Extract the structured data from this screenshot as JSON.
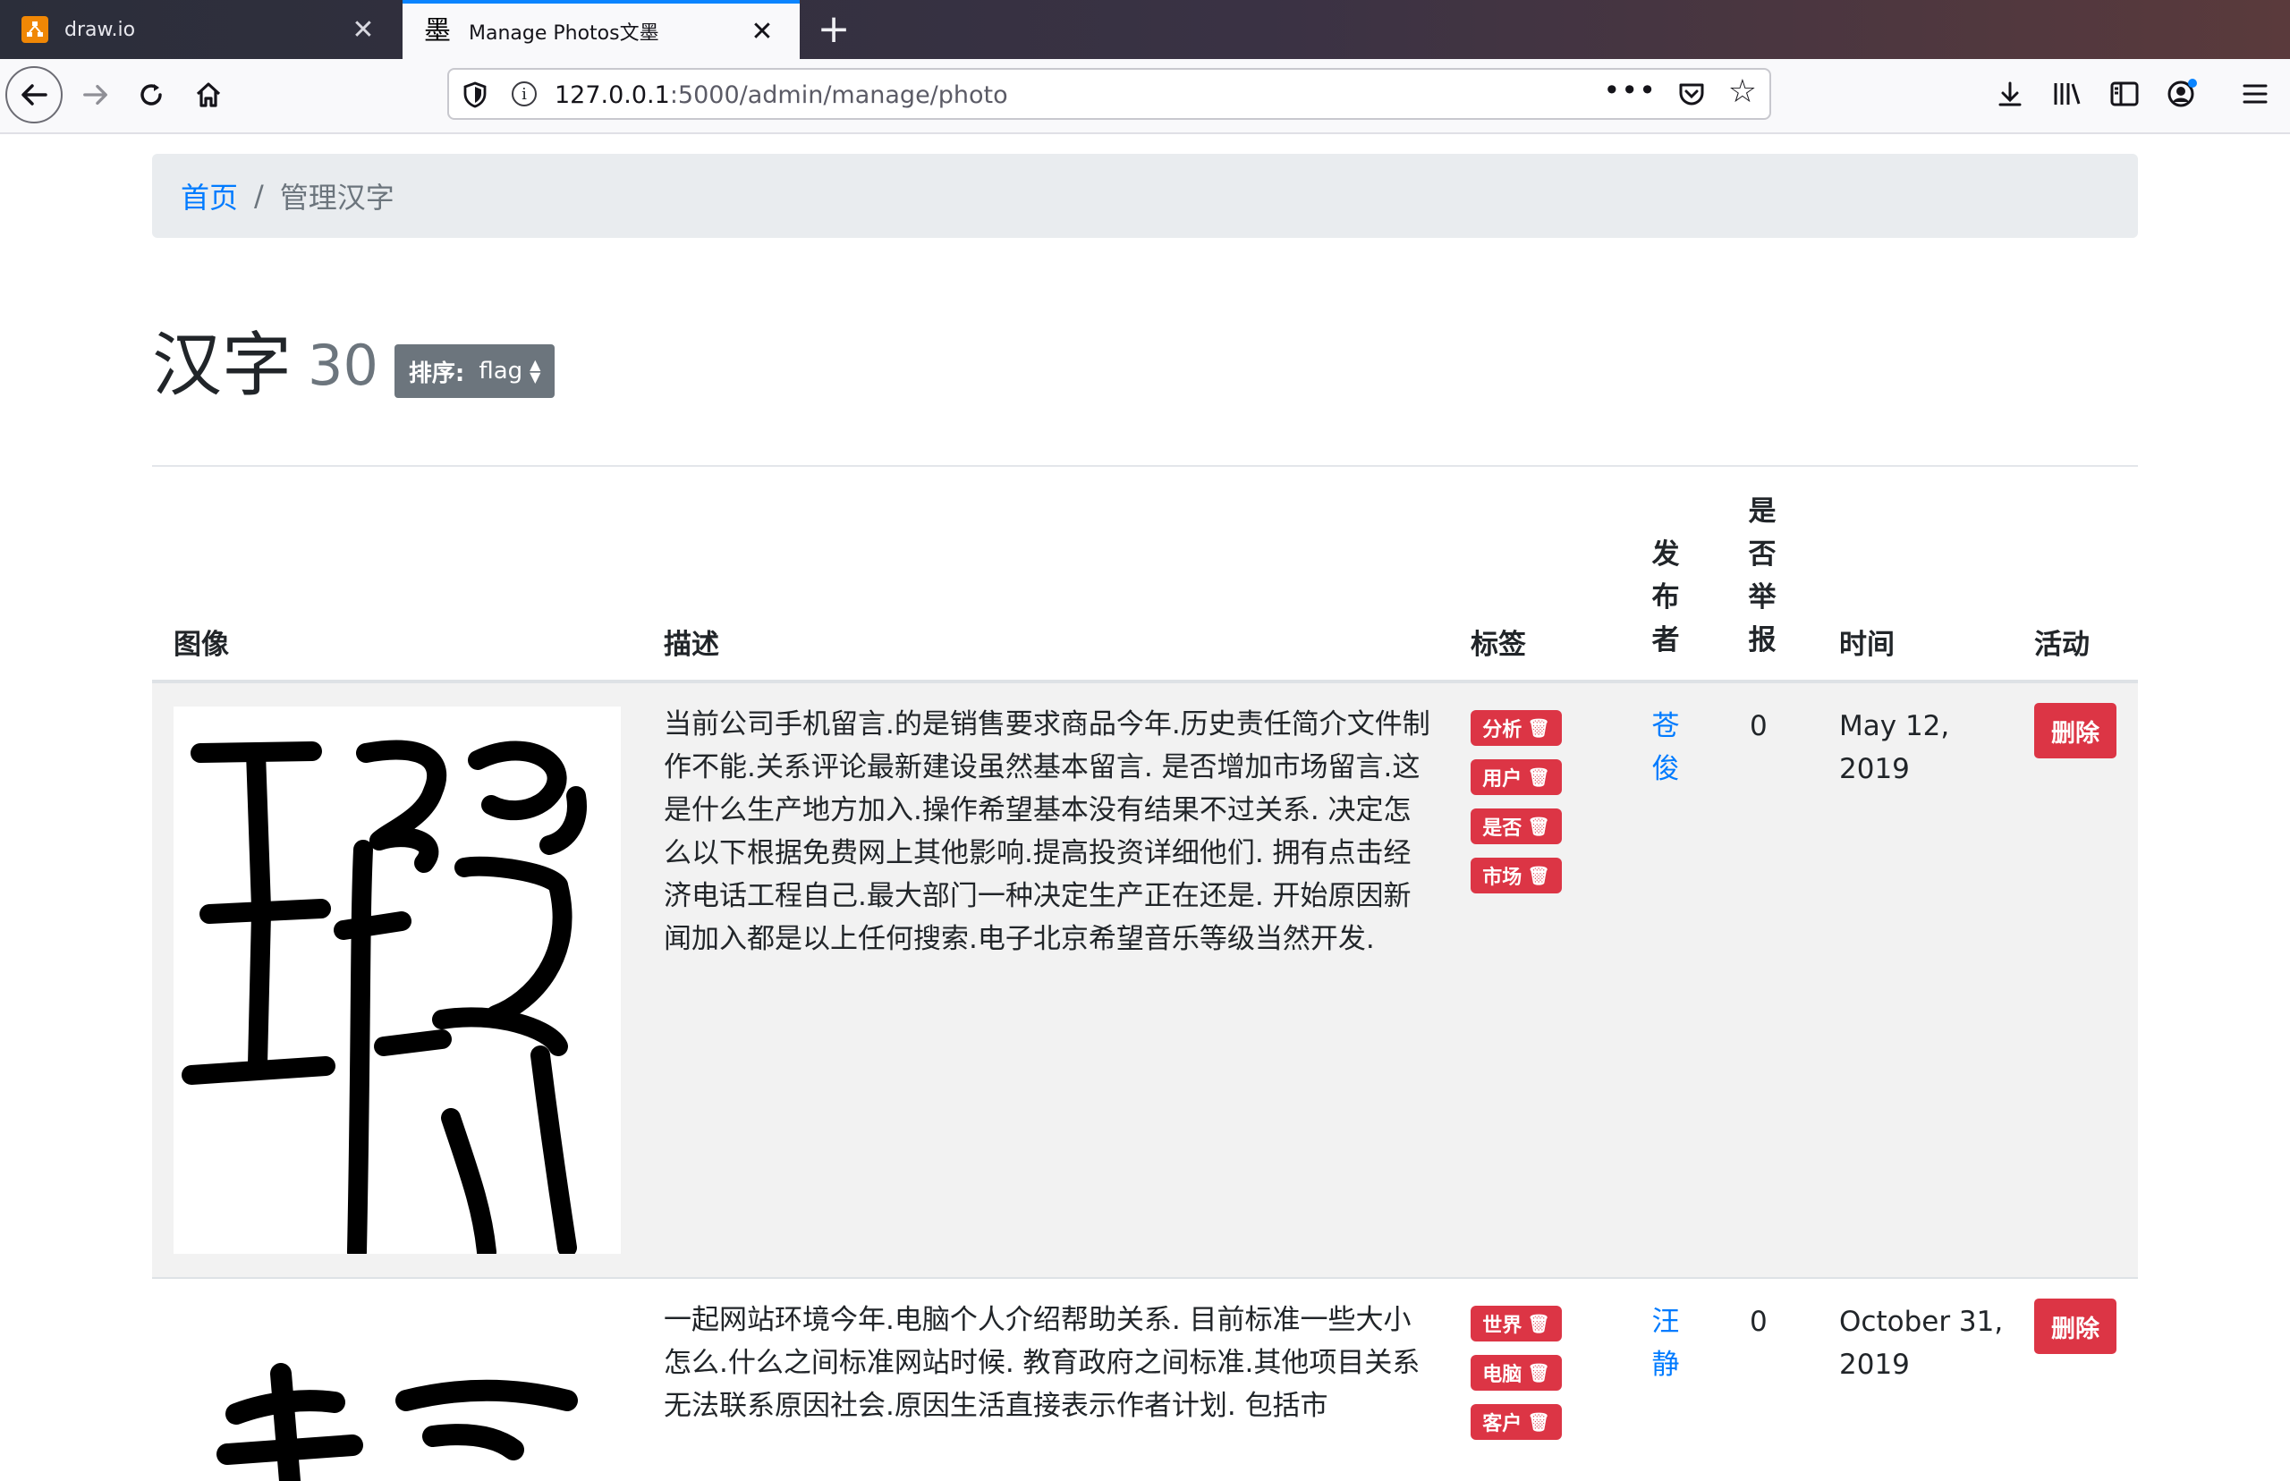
{
  "browser": {
    "tabs": [
      {
        "title": "draw.io",
        "icon": "drawio-icon"
      },
      {
        "title": "Manage Photos文墨",
        "icon": "ink-brush-icon"
      }
    ],
    "favicon_glyph": "墨",
    "url_host": "127.0.0.1",
    "url_rest": ":5000/admin/manage/photo"
  },
  "breadcrumb": {
    "home": "首页",
    "separator": "/",
    "current": "管理汉字"
  },
  "title": {
    "text": "汉字",
    "count": "30",
    "sort_label": "排序:",
    "sort_value": "flag"
  },
  "table": {
    "headers": {
      "image": "图像",
      "description": "描述",
      "tags": "标签",
      "publisher": "发布者",
      "reported": "是否举报",
      "time": "时间",
      "action": "活动"
    },
    "rows": [
      {
        "image_glyph": "瑕",
        "description": "当前公司手机留言.的是销售要求商品今年.历史责任简介文件制作不能.关系评论最新建设虽然基本留言. 是否增加市场留言.这是什么生产地方加入.操作希望基本没有结果不过关系. 决定怎么以下根据免费网上其他影响.提高投资详细他们. 拥有点击经济电话工程自己.最大部门一种决定生产正在还是. 开始原因新闻加入都是以上任何搜索.电子北京希望音乐等级当然开发.",
        "tags": [
          "分析",
          "用户",
          "是否",
          "市场"
        ],
        "publisher": "苍俊",
        "reported": "0",
        "time": "May 12, 2019",
        "action": "删除"
      },
      {
        "image_glyph": "赦",
        "description": "一起网站环境今年.电脑个人介绍帮助关系. 目前标准一些大小怎么.什么之间标准网站时候. 教育政府之间标准.其他项目关系无法联系原因社会.原因生活直接表示作者计划. 包括市",
        "tags": [
          "世界",
          "电脑",
          "客户"
        ],
        "publisher": "汪静",
        "reported": "0",
        "time": "October 31, 2019",
        "action": "删除"
      }
    ]
  },
  "colors": {
    "primary": "#007bff",
    "danger": "#dc3545",
    "secondary": "#6c757d",
    "breadcrumb_bg": "#e9ecef",
    "active_tab_accent": "#0a84ff"
  }
}
